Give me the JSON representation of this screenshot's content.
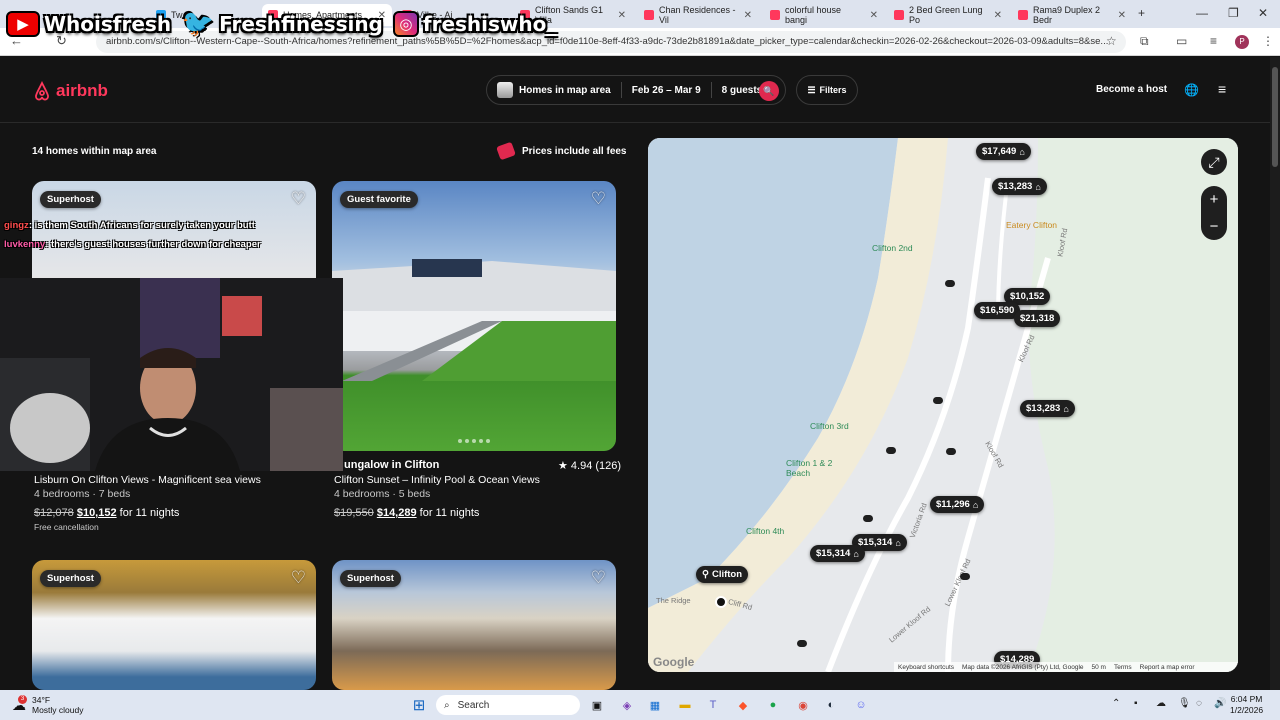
{
  "browser": {
    "tabs": [
      {
        "label": "Tw"
      },
      {
        "label": "Homes, Apartments"
      },
      {
        "label": "Vilhe - Ai"
      },
      {
        "label": "Clifton Sands G1 Villa"
      },
      {
        "label": "Chan Residences - Vil"
      },
      {
        "label": "colorful house bangi"
      },
      {
        "label": "2 Bed Green Lung Po"
      },
      {
        "label": "Rama9 Duplex 2 Bedr"
      }
    ],
    "url": "airbnb.com/s/Clifton--Western-Cape--South-Africa/homes?refinement_paths%5B%5D=%2Fhomes&acp_id=f0de110e-8eff-4f33-a9dc-73de2b81891a&date_picker_type=calendar&checkin=2026-02-26&checkout=2026-03-09&adults=8&se...",
    "profile_initial": "P"
  },
  "overlay": {
    "youtube": "Whoisfresh",
    "twitter": "Freshfinessing",
    "instagram": "freshiswho_"
  },
  "header": {
    "logo": "airbnb",
    "where": "Homes in map area",
    "dates": "Feb 26 – Mar 9",
    "guests": "8 guests",
    "filters": "Filters",
    "host": "Become a host"
  },
  "list": {
    "count": "14 homes within map area",
    "fees_note": "Prices include all fees",
    "cards": [
      {
        "badge": "Superhost",
        "title": "",
        "subtitle": "Lisburn On Clifton Views - Magnificent sea views",
        "details": "4 bedrooms · 7 beds",
        "old_price": "$12,078",
        "price": "$10,152",
        "period": "for 11 nights",
        "note": "Free cancellation"
      },
      {
        "badge": "Guest favorite",
        "title": "ungalow in Clifton",
        "rating": "★ 4.94 (126)",
        "subtitle": "Clifton Sunset – Infinity Pool & Ocean Views",
        "details": "4 bedrooms · 5 beds",
        "old_price": "$19,550",
        "price": "$14,289",
        "period": "for 11 nights"
      },
      {
        "badge": "Superhost"
      },
      {
        "badge": "Superhost"
      }
    ]
  },
  "chat": [
    {
      "user": "gingz",
      "text": ": is them South Africans for surely taken your butt",
      "color": "#ff4d4d"
    },
    {
      "user": "luvkenny",
      "text": ": there's guest houses further down for cheaper",
      "color": "#ff5ca8"
    }
  ],
  "map": {
    "pins": [
      {
        "label": "$17,649"
      },
      {
        "label": "$13,283"
      },
      {
        "label": "$10,152"
      },
      {
        "label": "$16,590"
      },
      {
        "label": "$21,318"
      },
      {
        "label": "$13,283"
      },
      {
        "label": "$11,296"
      },
      {
        "label": "$15,314"
      },
      {
        "label": "$15,314"
      },
      {
        "label": "$14,289"
      }
    ],
    "places": [
      "Clifton 2nd",
      "Clifton 3rd",
      "Clifton 1 & 2 Beach",
      "Clifton 4th",
      "Eatery Clifton"
    ],
    "roads": [
      "Kloof Rd",
      "Kloof Rd",
      "Kloof Rd",
      "Victoria Rd",
      "Lower Kloof Rd",
      "Lower Kloof Rd",
      "The Ridge",
      "Cliff Rd"
    ],
    "location_chip": "Clifton",
    "footer": [
      "Keyboard shortcuts",
      "Map data ©2026 AfriGIS (Pty) Ltd, Google",
      "50 m",
      "Terms",
      "Report a map error"
    ],
    "google": "Google"
  },
  "taskbar": {
    "temp": "34°F",
    "weather": "Mostly cloudy",
    "search": "Search",
    "time": "6:04 PM",
    "date": "1/2/2026",
    "weather_badge": "3"
  },
  "colors": {
    "brand": "#ff385c",
    "background": "#141414"
  }
}
